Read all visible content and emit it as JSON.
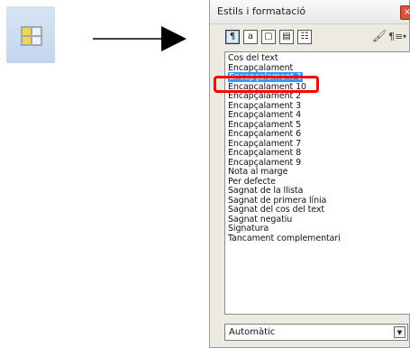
{
  "dialog": {
    "title": "Estils i formatació",
    "close_label": "×",
    "toolbar": {
      "buttons": [
        {
          "name": "paragraph-styles",
          "glyph": "¶"
        },
        {
          "name": "character-styles",
          "glyph": "a"
        },
        {
          "name": "frame-styles",
          "glyph": "▢"
        },
        {
          "name": "page-styles",
          "glyph": "▤"
        },
        {
          "name": "list-styles",
          "glyph": "☷"
        }
      ],
      "fill_glyph": "🖌",
      "new_style_glyph": "¶≡",
      "dropdown_glyph": "▾"
    },
    "styles": [
      "Cos del text",
      "Encapçalament",
      "Encapçalament 1",
      "Encapçalament 10",
      "Encapçalament 2",
      "Encapçalament 3",
      "Encapçalament 4",
      "Encapçalament 5",
      "Encapçalament 6",
      "Encapçalament 7",
      "Encapçalament 8",
      "Encapçalament 9",
      "Nota al marge",
      "Per defecte",
      "Sagnat de la llista",
      "Sagnat de primera línia",
      "Sagnat del cos del text",
      "Sagnat negatiu",
      "Signatura",
      "Tancament complementari"
    ],
    "selected_style": "Encapçalament 1",
    "filter_value": "Automàtic",
    "filter_arrow": "▼"
  }
}
